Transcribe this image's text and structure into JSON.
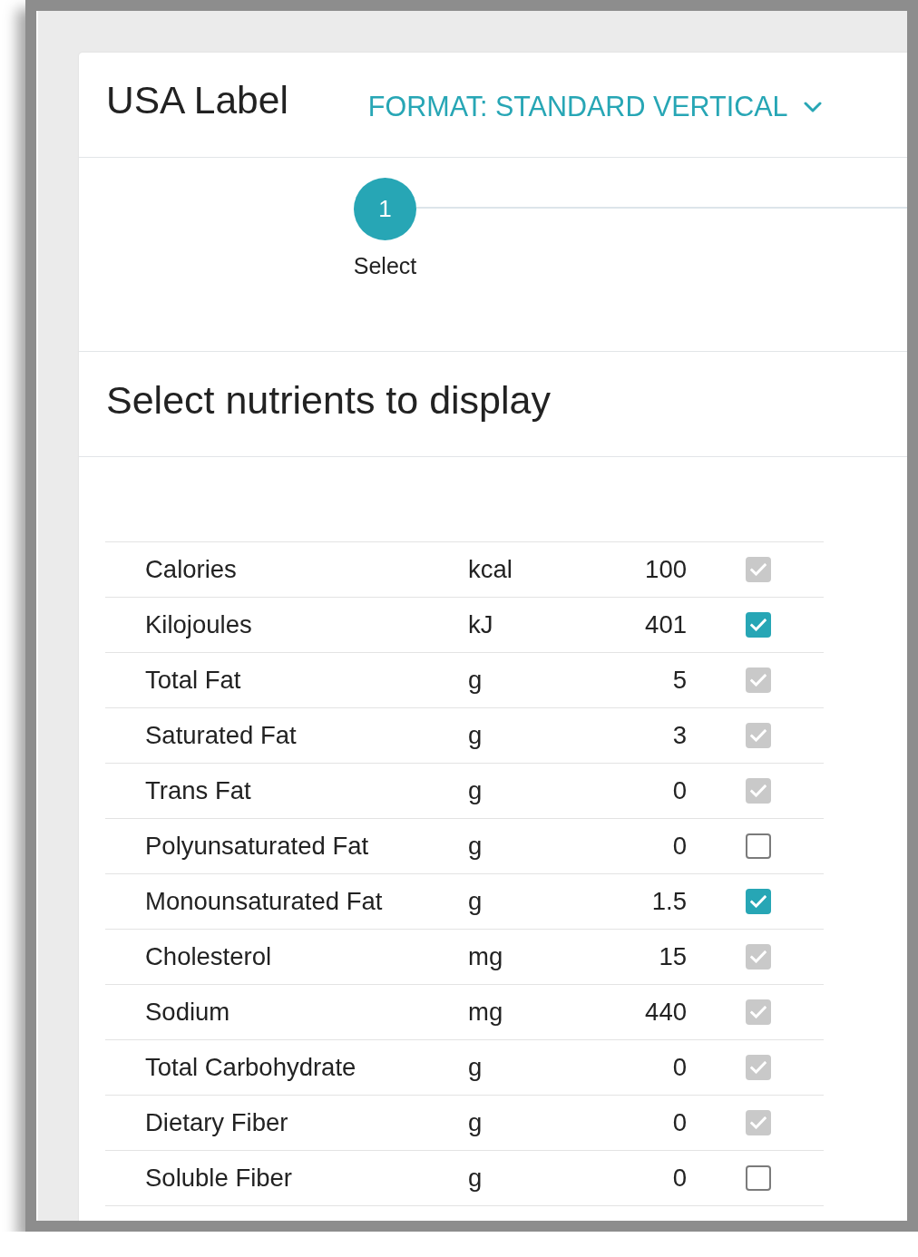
{
  "header": {
    "title": "USA Label",
    "format_dropdown": {
      "label": "FORMAT: STANDARD VERTICAL"
    }
  },
  "stepper": {
    "steps": [
      {
        "number": "1",
        "label": "Select",
        "selected": true
      }
    ]
  },
  "section": {
    "title": "Select nutrients to display"
  },
  "nutrients": [
    {
      "name": "Calories",
      "unit": "kcal",
      "amount": "100",
      "checked": true,
      "disabled": true
    },
    {
      "name": "Kilojoules",
      "unit": "kJ",
      "amount": "401",
      "checked": true,
      "disabled": false
    },
    {
      "name": "Total Fat",
      "unit": "g",
      "amount": "5",
      "checked": true,
      "disabled": true
    },
    {
      "name": "Saturated Fat",
      "unit": "g",
      "amount": "3",
      "checked": true,
      "disabled": true
    },
    {
      "name": "Trans Fat",
      "unit": "g",
      "amount": "0",
      "checked": true,
      "disabled": true
    },
    {
      "name": "Polyunsaturated Fat",
      "unit": "g",
      "amount": "0",
      "checked": false,
      "disabled": false
    },
    {
      "name": "Monounsaturated Fat",
      "unit": "g",
      "amount": "1.5",
      "checked": true,
      "disabled": false
    },
    {
      "name": "Cholesterol",
      "unit": "mg",
      "amount": "15",
      "checked": true,
      "disabled": true
    },
    {
      "name": "Sodium",
      "unit": "mg",
      "amount": "440",
      "checked": true,
      "disabled": true
    },
    {
      "name": "Total Carbohydrate",
      "unit": "g",
      "amount": "0",
      "checked": true,
      "disabled": true
    },
    {
      "name": "Dietary Fiber",
      "unit": "g",
      "amount": "0",
      "checked": true,
      "disabled": true
    },
    {
      "name": "Soluble Fiber",
      "unit": "g",
      "amount": "0",
      "checked": false,
      "disabled": false
    }
  ]
}
